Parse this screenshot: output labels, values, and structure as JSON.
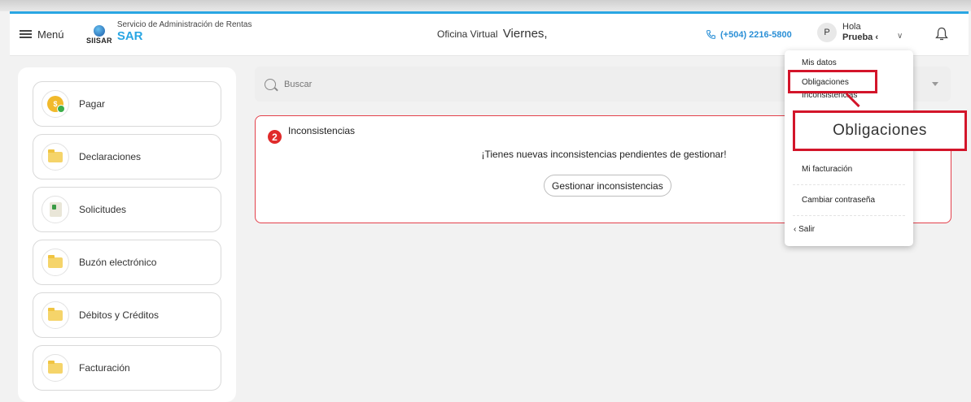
{
  "header": {
    "menu_label": "Menú",
    "logo_small": "SIISAR",
    "logo_subtitle": "Servicio de Administración de Rentas",
    "logo_title": "SAR",
    "office_label": "Oficina Virtual",
    "office_day": "Viernes,",
    "phone": "(+504) 2216-5800",
    "avatar_initial": "P",
    "greeting": "Hola",
    "user_name": "Prueba ‹"
  },
  "sidebar": {
    "items": [
      {
        "label": "Pagar",
        "icon": "coin-icon"
      },
      {
        "label": "Declaraciones",
        "icon": "folder-icon"
      },
      {
        "label": "Solicitudes",
        "icon": "document-icon"
      },
      {
        "label": "Buzón electrónico",
        "icon": "folder-icon"
      },
      {
        "label": "Débitos y Créditos",
        "icon": "folder-icon"
      },
      {
        "label": "Facturación",
        "icon": "folder-icon"
      }
    ]
  },
  "search": {
    "placeholder": "Buscar"
  },
  "alert": {
    "count": "2",
    "title": "Inconsistencias",
    "message": "¡Tienes nuevas inconsistencias pendientes de gestionar!",
    "button_label": "Gestionar inconsistencias"
  },
  "user_menu": {
    "items": [
      "Mis datos",
      "Obligaciones",
      "Inconsistencias",
      "Mi facturación",
      "Cambiar contraseña",
      "Salir"
    ]
  },
  "zoom_callout": {
    "label": "Obligaciones"
  },
  "colors": {
    "accent": "#29a6e3",
    "phone": "#2a8fd6",
    "alert_border": "#e3404b",
    "highlight": "#d3152a"
  }
}
